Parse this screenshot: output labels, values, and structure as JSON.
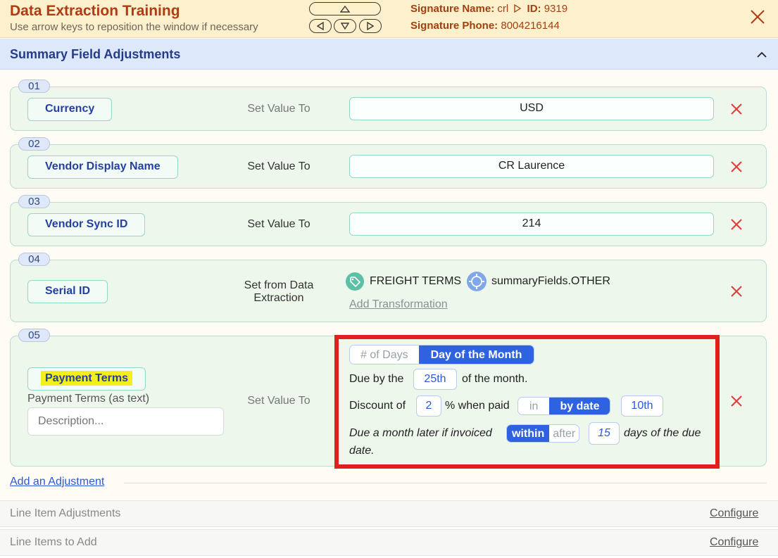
{
  "header": {
    "title": "Data Extraction Training",
    "subtitle": "Use arrow keys to reposition the window if necessary",
    "signature_name_label": "Signature Name:",
    "signature_name_value": "crl",
    "id_label": "ID:",
    "id_value": "9319",
    "signature_phone_label": "Signature Phone:",
    "signature_phone_value": "8004216144",
    "nav_icons": [
      "arrow-up-icon",
      "arrow-left-icon",
      "arrow-down-icon",
      "arrow-right-icon"
    ]
  },
  "section": {
    "title": "Summary Field Adjustments"
  },
  "adjustments": [
    {
      "num": "01",
      "field": "Currency",
      "action": "Set Value To",
      "value": "USD"
    },
    {
      "num": "02",
      "field": "Vendor Display Name",
      "action": "Set Value To",
      "value": "CR Laurence"
    },
    {
      "num": "03",
      "field": "Vendor Sync ID",
      "action": "Set Value To",
      "value": "214"
    },
    {
      "num": "04",
      "field": "Serial ID",
      "action_line1": "Set from Data",
      "action_line2": "Extraction",
      "tag": "FREIGHT TERMS",
      "target": "summaryFields.OTHER",
      "add_transformation": "Add Transformation"
    },
    {
      "num": "05",
      "field": "Payment Terms",
      "action": "Set Value To",
      "text_label": "Payment Terms (as text)",
      "description_placeholder": "Description..."
    }
  ],
  "terms": {
    "mode_days": "# of Days",
    "mode_month": "Day of the Month",
    "due_prefix": "Due by the",
    "due_value": "25th",
    "due_suffix": "of the month.",
    "discount_prefix": "Discount of",
    "discount_value": "2",
    "discount_mid": "% when paid",
    "when_in": "in",
    "when_by_date": "by date",
    "paid_value": "10th",
    "later_prefix": "Due a month later if invoiced",
    "opt_within": "within",
    "opt_after": "after",
    "later_value": "15",
    "later_suffix_1": "days of the due",
    "later_suffix_2": "date."
  },
  "footer": {
    "add_adjustment": "Add an Adjustment",
    "line_item_adjustments": "Line Item Adjustments",
    "line_items_to_add": "Line Items to Add",
    "configure": "Configure"
  },
  "colors": {
    "title": "#b23a12",
    "accent_blue": "#2f62e0",
    "remove_red": "#e03a3a",
    "highlight_box": "#e01f1f",
    "highlight_text": "#f4ee1c"
  }
}
